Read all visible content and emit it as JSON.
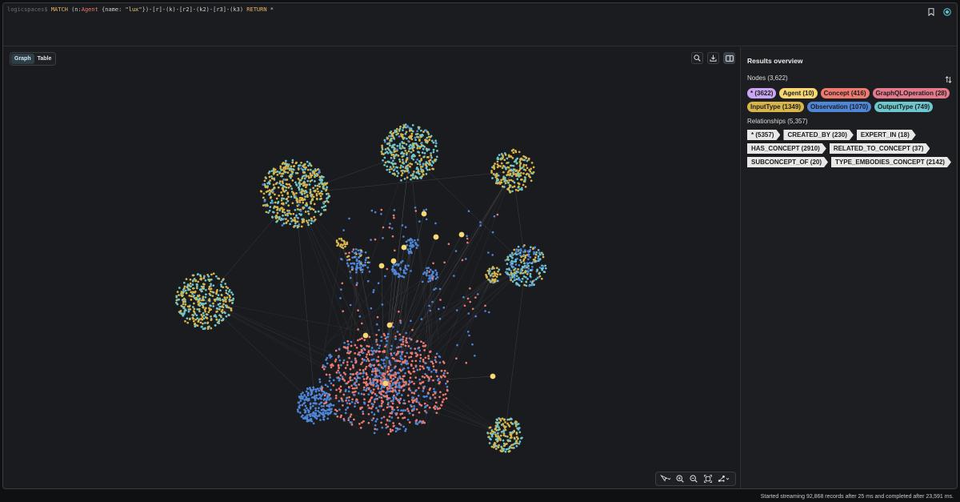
{
  "editor": {
    "prompt": "logicspaces$",
    "query_parts": [
      {
        "t": "MATCH",
        "c": "kw"
      },
      {
        "t": " (n:",
        "c": "plain"
      },
      {
        "t": "Agent",
        "c": "label"
      },
      {
        "t": " {name: ",
        "c": "plain"
      },
      {
        "t": "\"lux\"",
        "c": "str"
      },
      {
        "t": "})-[r]-(k)-[r2]-(k2)-[r3]-(k3) ",
        "c": "plain"
      },
      {
        "t": "RETURN",
        "c": "kw"
      },
      {
        "t": " *",
        "c": "plain"
      }
    ]
  },
  "view_tabs": [
    {
      "label": "Graph",
      "active": true
    },
    {
      "label": "Table",
      "active": false
    }
  ],
  "graph_buttons": [
    "search-icon",
    "download-icon",
    "panel-toggle-icon"
  ],
  "toolbar_icons": [
    "pointer-icon",
    "zoom-in-icon",
    "zoom-out-icon",
    "fit-icon",
    "layout-icon"
  ],
  "panel": {
    "title": "Results overview",
    "nodes_title": "Nodes (3,622)",
    "node_labels": [
      {
        "label": "* (3622)",
        "color": "#c9a7f5"
      },
      {
        "label": "Agent (10)",
        "color": "#f7d873"
      },
      {
        "label": "Concept (416)",
        "color": "#ef7a6e"
      },
      {
        "label": "GraphQLOperation (28)",
        "color": "#e47a8b"
      },
      {
        "label": "InputType (1349)",
        "color": "#d9b64b"
      },
      {
        "label": "Observation (1070)",
        "color": "#4f86d8"
      },
      {
        "label": "OutputType (749)",
        "color": "#6ec7cf"
      }
    ],
    "rels_title": "Relationships (5,357)",
    "rel_types": [
      {
        "label": "* (5357)"
      },
      {
        "label": "CREATED_BY (230)"
      },
      {
        "label": "EXPERT_IN (18)"
      },
      {
        "label": "HAS_CONCEPT (2910)"
      },
      {
        "label": "RELATED_TO_CONCEPT (37)"
      },
      {
        "label": "SUBCONCEPT_OF (20)"
      },
      {
        "label": "TYPE_EMBODIES_CONCEPT (2142)"
      }
    ]
  },
  "status": "Started streaming 92,868 records after 25 ms and completed after 23,591 ms.",
  "colors": {
    "agent": "#f7d873",
    "concept": "#ef7a6e",
    "input_type": "#d9b64b",
    "observation": "#4f86d8",
    "output_type": "#6ec7cf"
  }
}
